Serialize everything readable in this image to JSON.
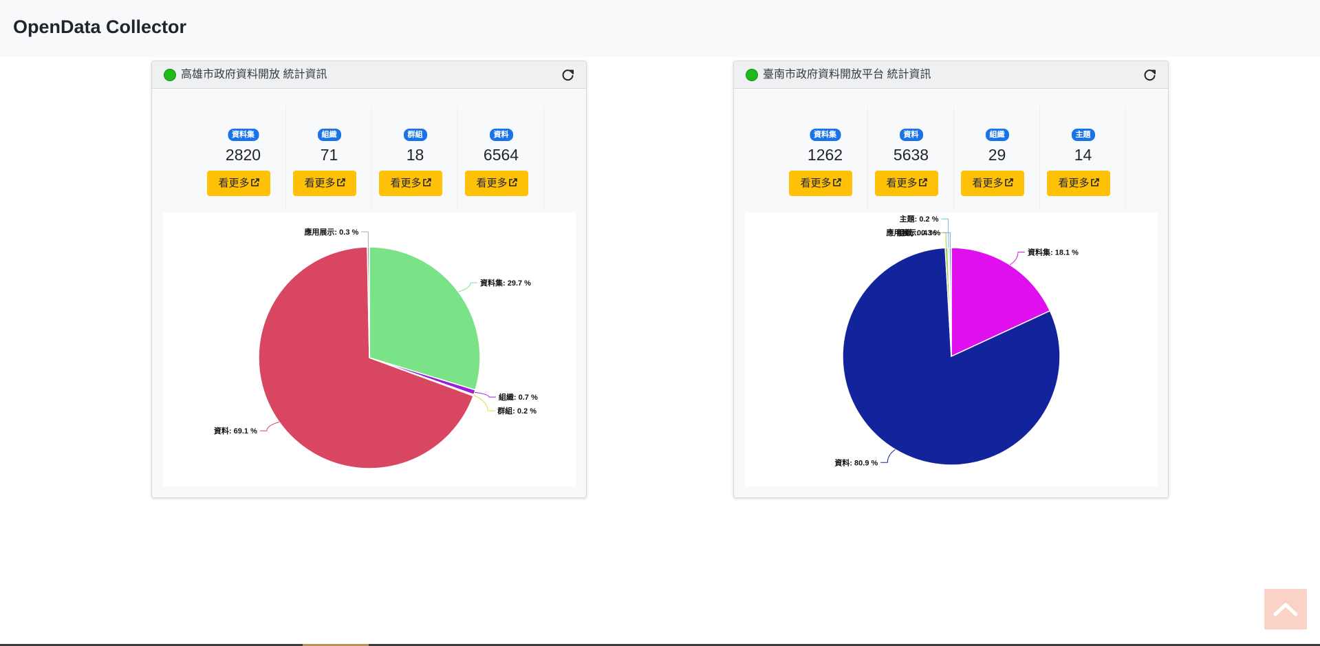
{
  "app": {
    "title": "OpenData Collector"
  },
  "panels": [
    {
      "title": "高雄市政府資料開放 統計資訊",
      "stats": [
        {
          "badge": "資料集",
          "count": "2820",
          "button": "看更多"
        },
        {
          "badge": "組織",
          "count": "71",
          "button": "看更多"
        },
        {
          "badge": "群組",
          "count": "18",
          "button": "看更多"
        },
        {
          "badge": "資料",
          "count": "6564",
          "button": "看更多"
        }
      ]
    },
    {
      "title": "臺南市政府資料開放平台 統計資訊",
      "stats": [
        {
          "badge": "資料集",
          "count": "1262",
          "button": "看更多"
        },
        {
          "badge": "資料",
          "count": "5638",
          "button": "看更多"
        },
        {
          "badge": "組織",
          "count": "29",
          "button": "看更多"
        },
        {
          "badge": "主題",
          "count": "14",
          "button": "看更多"
        }
      ]
    }
  ],
  "chart_data": [
    {
      "type": "pie",
      "title": "",
      "slices": [
        {
          "label": "資料集",
          "value": 29.7,
          "display": "29.7 %",
          "color": "#7be387"
        },
        {
          "label": "組織",
          "value": 0.7,
          "display": "0.7 %",
          "color": "#9b1fd6"
        },
        {
          "label": "群組",
          "value": 0.2,
          "display": "0.2 %",
          "color": "#d8e04a"
        },
        {
          "label": "資料",
          "value": 69.1,
          "display": "69.1 %",
          "color": "#d84661"
        },
        {
          "label": "應用展示",
          "value": 0.3,
          "display": "0.3 %",
          "color": "#a7a7a7"
        }
      ]
    },
    {
      "type": "pie",
      "title": "",
      "slices": [
        {
          "label": "資料集",
          "value": 18.1,
          "display": "18.1 %",
          "color": "#e010ee"
        },
        {
          "label": "資料",
          "value": 80.9,
          "display": "80.9 %",
          "color": "#13239b"
        },
        {
          "label": "組織",
          "value": 0.4,
          "display": "0.4 %",
          "color": "#a8c94a"
        },
        {
          "label": "主題",
          "value": 0.2,
          "display": "0.2 %",
          "color": "#6fc3ee"
        },
        {
          "label": "應用展示",
          "value": 0.3,
          "display": "0.3 %",
          "color": "#7aa0d6"
        }
      ]
    }
  ],
  "colors": {
    "brand_badge": "#1a73e8",
    "button": "#ffc107",
    "status": "#1fb91a"
  },
  "icons": {
    "refresh": "refresh-icon",
    "external": "external-link-icon",
    "scroll": "chevron-up-icon",
    "status": "status-dot"
  }
}
